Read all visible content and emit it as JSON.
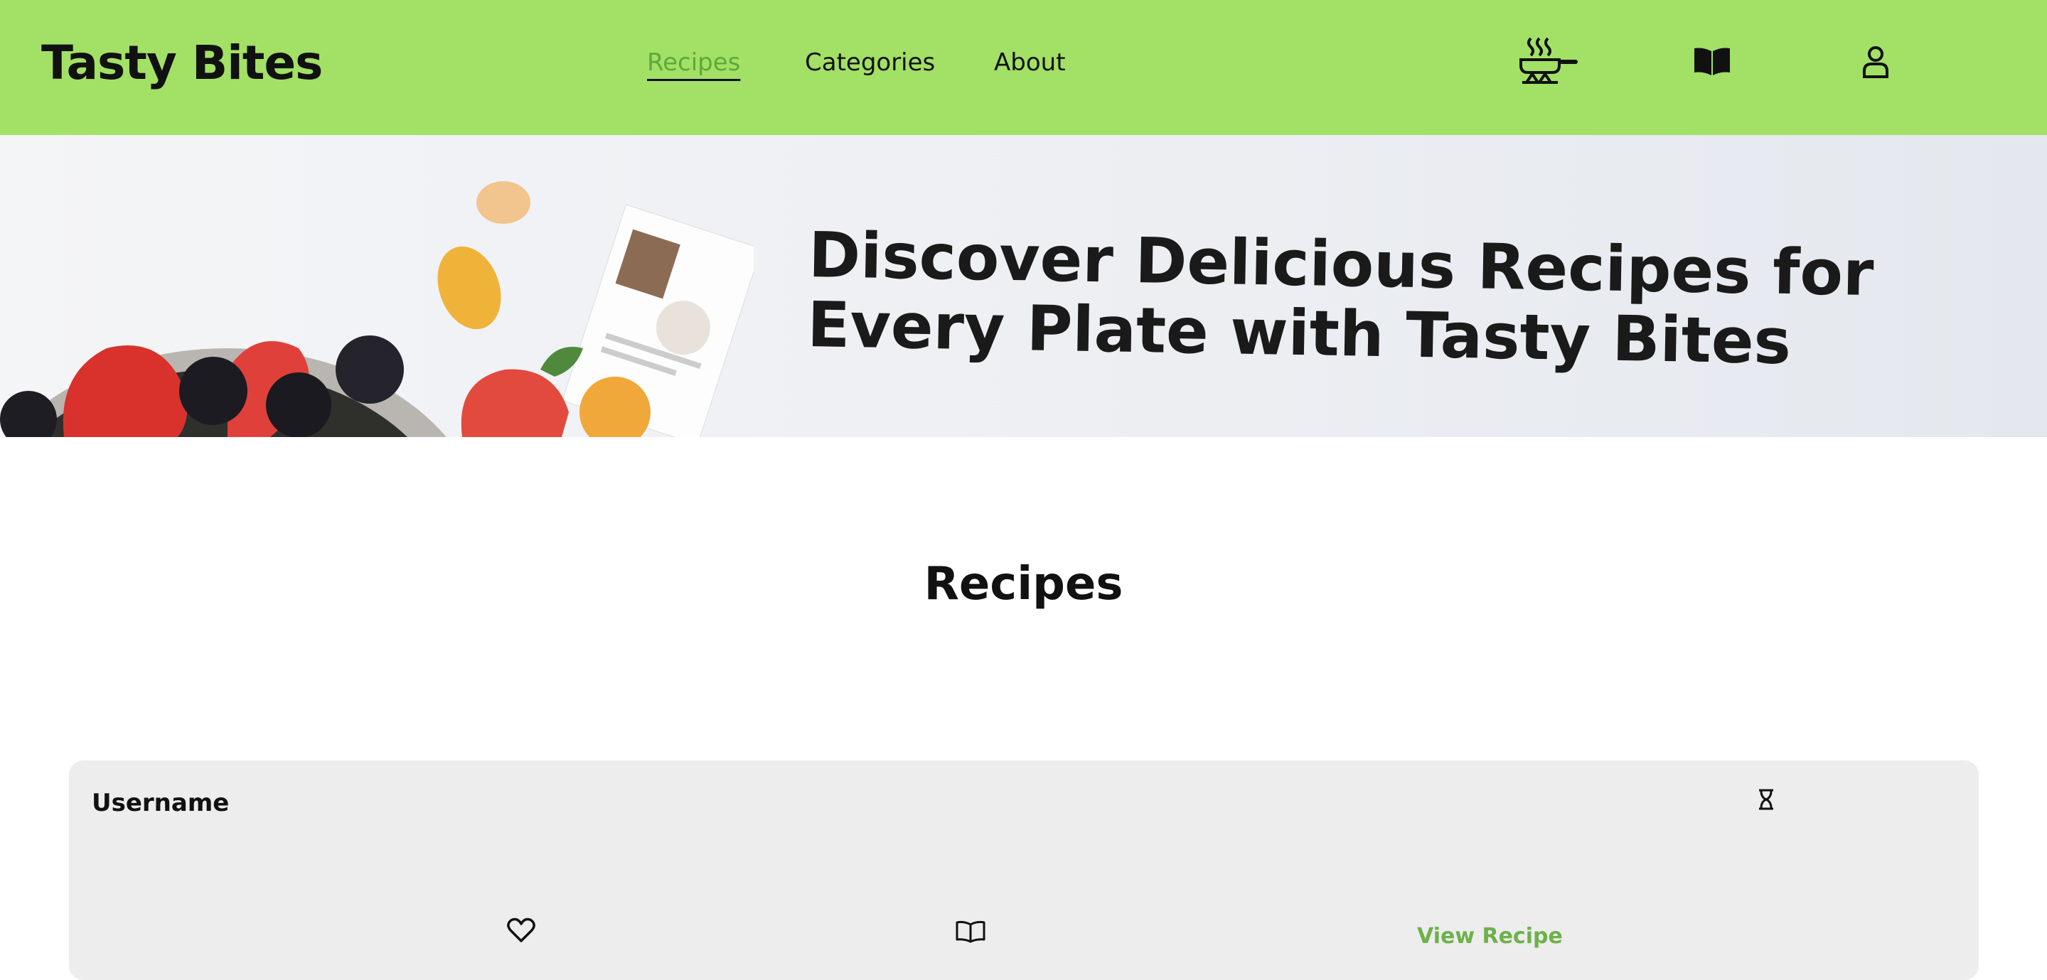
{
  "header": {
    "logo": "Tasty Bites",
    "nav": [
      {
        "label": "Recipes",
        "active": true
      },
      {
        "label": "Categories",
        "active": false
      },
      {
        "label": "About",
        "active": false
      }
    ],
    "icons": [
      "cooking-pan-icon",
      "book-icon",
      "user-icon"
    ]
  },
  "hero": {
    "headline": "Discover Delicious Recipes for Every Plate with Tasty Bites"
  },
  "main": {
    "section_title": "Recipes",
    "card": {
      "username": "Username",
      "view_label": "View Recipe",
      "icons": [
        "hourglass-icon",
        "heart-icon",
        "open-book-icon"
      ]
    }
  },
  "colors": {
    "header_bg": "#a3e066",
    "accent": "#6db14a",
    "card_bg": "#ededed"
  }
}
